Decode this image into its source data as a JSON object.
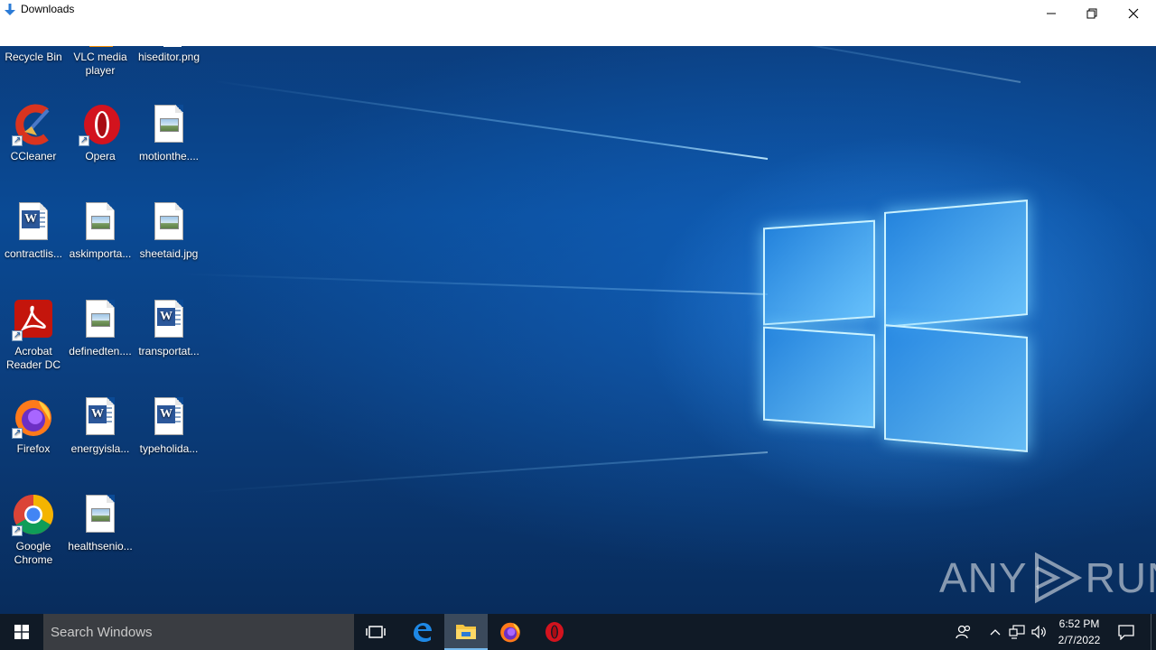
{
  "window": {
    "title": "Downloads",
    "icon": "download-arrow-icon"
  },
  "desktop_icons": [
    {
      "label": "Recycle Bin",
      "icon": "recycle-bin-icon"
    },
    {
      "label": "VLC media player",
      "icon": "vlc-icon"
    },
    {
      "label": "hiseditor.png",
      "icon": "image-file-icon"
    },
    {
      "label": "CCleaner",
      "icon": "ccleaner-icon"
    },
    {
      "label": "Opera",
      "icon": "opera-icon"
    },
    {
      "label": "motionthe....",
      "icon": "image-file-icon"
    },
    {
      "label": "contractlis...",
      "icon": "word-doc-icon"
    },
    {
      "label": "askimporta...",
      "icon": "image-file-icon"
    },
    {
      "label": "sheetaid.jpg",
      "icon": "image-file-icon"
    },
    {
      "label": "Acrobat Reader DC",
      "icon": "acrobat-icon"
    },
    {
      "label": "definedten....",
      "icon": "image-file-icon"
    },
    {
      "label": "transportat...",
      "icon": "word-doc-icon"
    },
    {
      "label": "Firefox",
      "icon": "firefox-icon"
    },
    {
      "label": "energyisla...",
      "icon": "word-doc-icon"
    },
    {
      "label": "typeholida...",
      "icon": "word-doc-icon"
    },
    {
      "label": "Google Chrome",
      "icon": "chrome-icon"
    },
    {
      "label": "healthsenio...",
      "icon": "image-file-icon"
    }
  ],
  "taskbar": {
    "search_placeholder": "Search Windows",
    "apps": [
      "task-view-icon",
      "edge-icon",
      "file-explorer-icon",
      "firefox-icon",
      "opera-icon"
    ],
    "clock_time": "6:52 PM",
    "clock_date": "2/7/2022"
  },
  "watermark": {
    "left": "ANY",
    "right": "RUN"
  },
  "colors": {
    "taskbar": "#101a26",
    "search_box": "#3a3d42",
    "active_app": "#3b4a5c",
    "accent": "#76b9ed"
  }
}
